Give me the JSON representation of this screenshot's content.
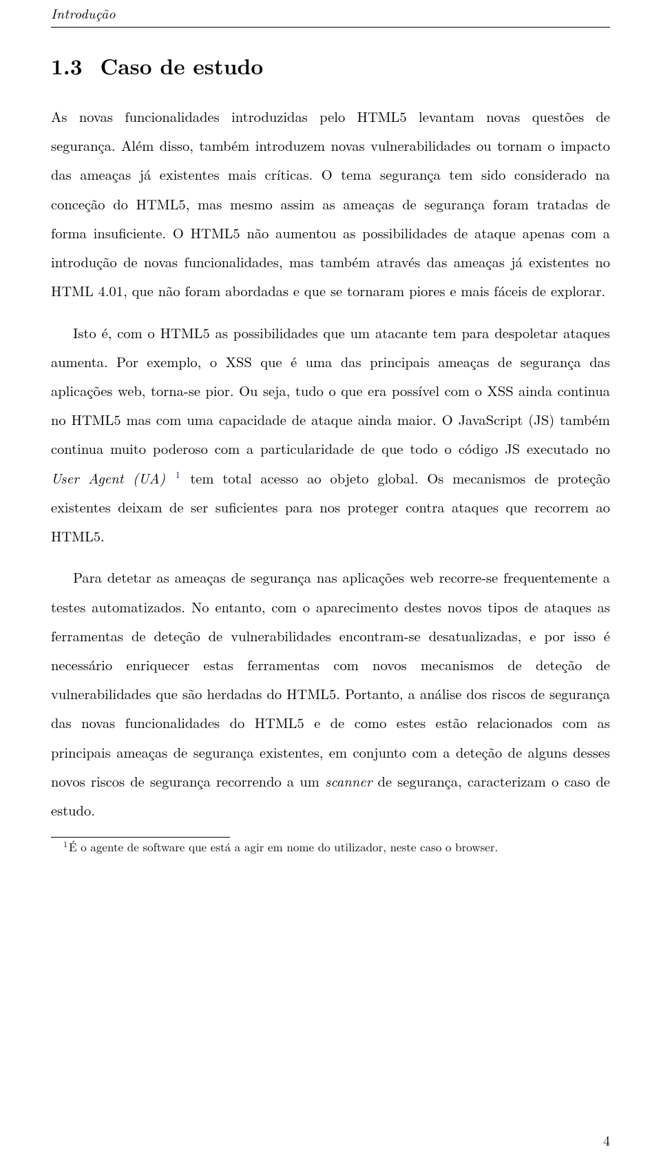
{
  "header": {
    "running": "Introdução"
  },
  "section": {
    "number": "1.3",
    "title": "Caso de estudo"
  },
  "paragraphs": {
    "p1_a": "As novas funcionalidades introduzidas pelo HTML5 levantam novas questões de segurança. Além disso, também introduzem novas vulnerabilidades ou tornam o impacto das ameaças já existentes mais críticas. O tema segurança tem sido considerado na conceção do HTML5, mas mesmo assim as ameaças de segurança foram tratadas de forma insuficiente. O HTML5 não aumentou as possibilidades de ataque apenas com a introdução de novas funcionalidades, mas também através das ameaças já existentes no HTML 4.01, que não foram abordadas e que se tornaram piores e mais fáceis de explorar.",
    "p2_a": "Isto é, com o HTML5 as possibilidades que um atacante tem para despoletar ataques aumenta. Por exemplo, o XSS que é uma das principais ameaças de segurança das aplicações web, torna-se pior. Ou seja, tudo o que era possível com o XSS ainda continua no HTML5 mas com uma capacidade de ataque ainda maior. O JavaScript (JS) também continua muito poderoso com a particularidade de que todo o código JS executado no ",
    "p2_ua": "User Agent (UA)",
    "p2_fnref": "1",
    "p2_b": " tem total acesso ao objeto global. Os mecanismos de proteção existentes deixam de ser suficientes para nos proteger contra ataques que recorrem ao HTML5.",
    "p3_a": "Para detetar as ameaças de segurança nas aplicações web recorre-se frequentemente a testes automatizados. No entanto, com o aparecimento destes novos tipos de ataques as ferramentas de deteção de vulnerabilidades encontram-se desatualizadas, e por isso é necessário enriquecer estas ferramentas com novos mecanismos de deteção de vulnerabilidades que são herdadas do HTML5. Portanto, a análise dos riscos de segurança das novas funcionalidades do HTML5 e de como estes estão relacionados com as principais ameaças de segurança existentes, em conjunto com a deteção de alguns desses novos riscos de segurança recorrendo a um ",
    "p3_scanner": "scanner",
    "p3_b": " de segurança, caracterizam o caso de estudo."
  },
  "footnote": {
    "num": "1",
    "text": "É o agente de software que está a agir em nome do utilizador, neste caso o browser."
  },
  "page_number": "4"
}
